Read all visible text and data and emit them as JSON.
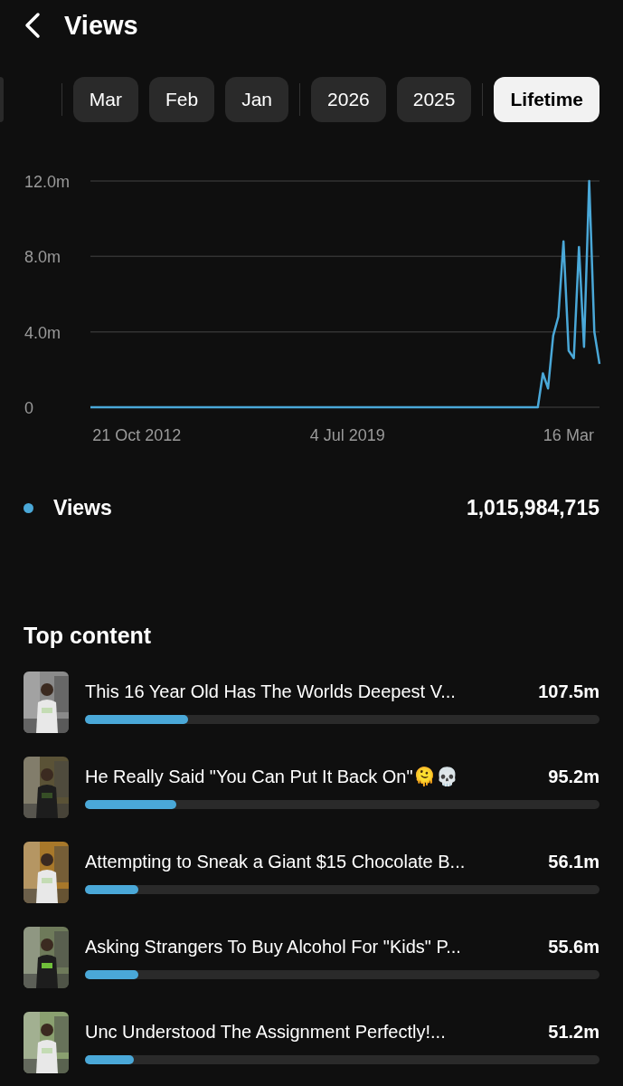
{
  "header": {
    "title": "Views"
  },
  "tab_groups": [
    [
      {
        "label": "Mar",
        "selected": false
      },
      {
        "label": "Feb",
        "selected": false
      },
      {
        "label": "Jan",
        "selected": false
      }
    ],
    [
      {
        "label": "2026",
        "selected": false
      },
      {
        "label": "2025",
        "selected": false
      }
    ],
    [
      {
        "label": "Lifetime",
        "selected": true
      }
    ]
  ],
  "chart_data": {
    "type": "line",
    "ylim": [
      0,
      12
    ],
    "yticks": [
      {
        "value": 0,
        "label": "0"
      },
      {
        "value": 4,
        "label": "4.0m"
      },
      {
        "value": 8,
        "label": "8.0m"
      },
      {
        "value": 12,
        "label": "12.0m"
      }
    ],
    "categories": [
      null,
      null,
      null,
      null,
      null,
      null,
      null,
      null,
      null,
      "21 Oct 2012",
      null,
      null,
      null,
      null,
      null,
      null,
      null,
      null,
      null,
      null,
      null,
      null,
      null,
      null,
      null,
      null,
      null,
      null,
      null,
      null,
      null,
      null,
      null,
      null,
      null,
      null,
      null,
      null,
      null,
      null,
      null,
      null,
      null,
      null,
      null,
      null,
      null,
      null,
      null,
      null,
      "4 Jul 2019",
      null,
      null,
      null,
      null,
      null,
      null,
      null,
      null,
      null,
      null,
      null,
      null,
      null,
      null,
      null,
      null,
      null,
      null,
      null,
      null,
      null,
      null,
      null,
      null,
      null,
      null,
      null,
      null,
      null,
      null,
      null,
      null,
      null,
      null,
      null,
      null,
      null,
      null,
      null,
      null,
      null,
      null,
      "16 Mar",
      null,
      null,
      null,
      null,
      null,
      null
    ],
    "series": [
      {
        "name": "Views",
        "color": "#4aa8d8",
        "values": [
          0,
          0,
          0,
          0,
          0,
          0,
          0,
          0,
          0,
          0,
          0,
          0,
          0,
          0,
          0,
          0,
          0,
          0,
          0,
          0,
          0,
          0,
          0,
          0,
          0,
          0,
          0,
          0,
          0,
          0,
          0,
          0,
          0,
          0,
          0,
          0,
          0,
          0,
          0,
          0,
          0,
          0,
          0,
          0,
          0,
          0,
          0,
          0,
          0,
          0,
          0,
          0,
          0,
          0,
          0,
          0,
          0,
          0,
          0,
          0,
          0,
          0,
          0,
          0,
          0,
          0,
          0,
          0,
          0,
          0,
          0,
          0,
          0,
          0,
          0,
          0,
          0,
          0,
          0,
          0,
          0,
          0,
          0,
          0,
          0,
          0,
          0,
          0,
          1.8,
          1.0,
          3.8,
          4.8,
          8.8,
          3.0,
          2.6,
          8.5,
          3.2,
          12.0,
          4.0,
          2.3
        ]
      }
    ]
  },
  "legend": {
    "total": "1,015,984,715"
  },
  "top_content": {
    "title": "Top content",
    "items": [
      {
        "title": "This 16 Year Old Has The Worlds Deepest V...",
        "value": "107.5m",
        "level": 0.2,
        "kind": "picture"
      },
      {
        "title": "He Really Said \"You Can Put It Back On\"🫠💀",
        "value": "95.2m",
        "level": 0.178,
        "kind": "picture"
      },
      {
        "title": "Attempting to Sneak a Giant $15 Chocolate B...",
        "value": "56.1m",
        "level": 0.104,
        "kind": "picture"
      },
      {
        "title": "Asking Strangers To Buy Alcohol For \"Kids\" P...",
        "value": "55.6m",
        "level": 0.104,
        "kind": "picture"
      },
      {
        "title": "Unc Understood The Assignment Perfectly!...",
        "value": "51.2m",
        "level": 0.095,
        "kind": "picture"
      }
    ]
  }
}
